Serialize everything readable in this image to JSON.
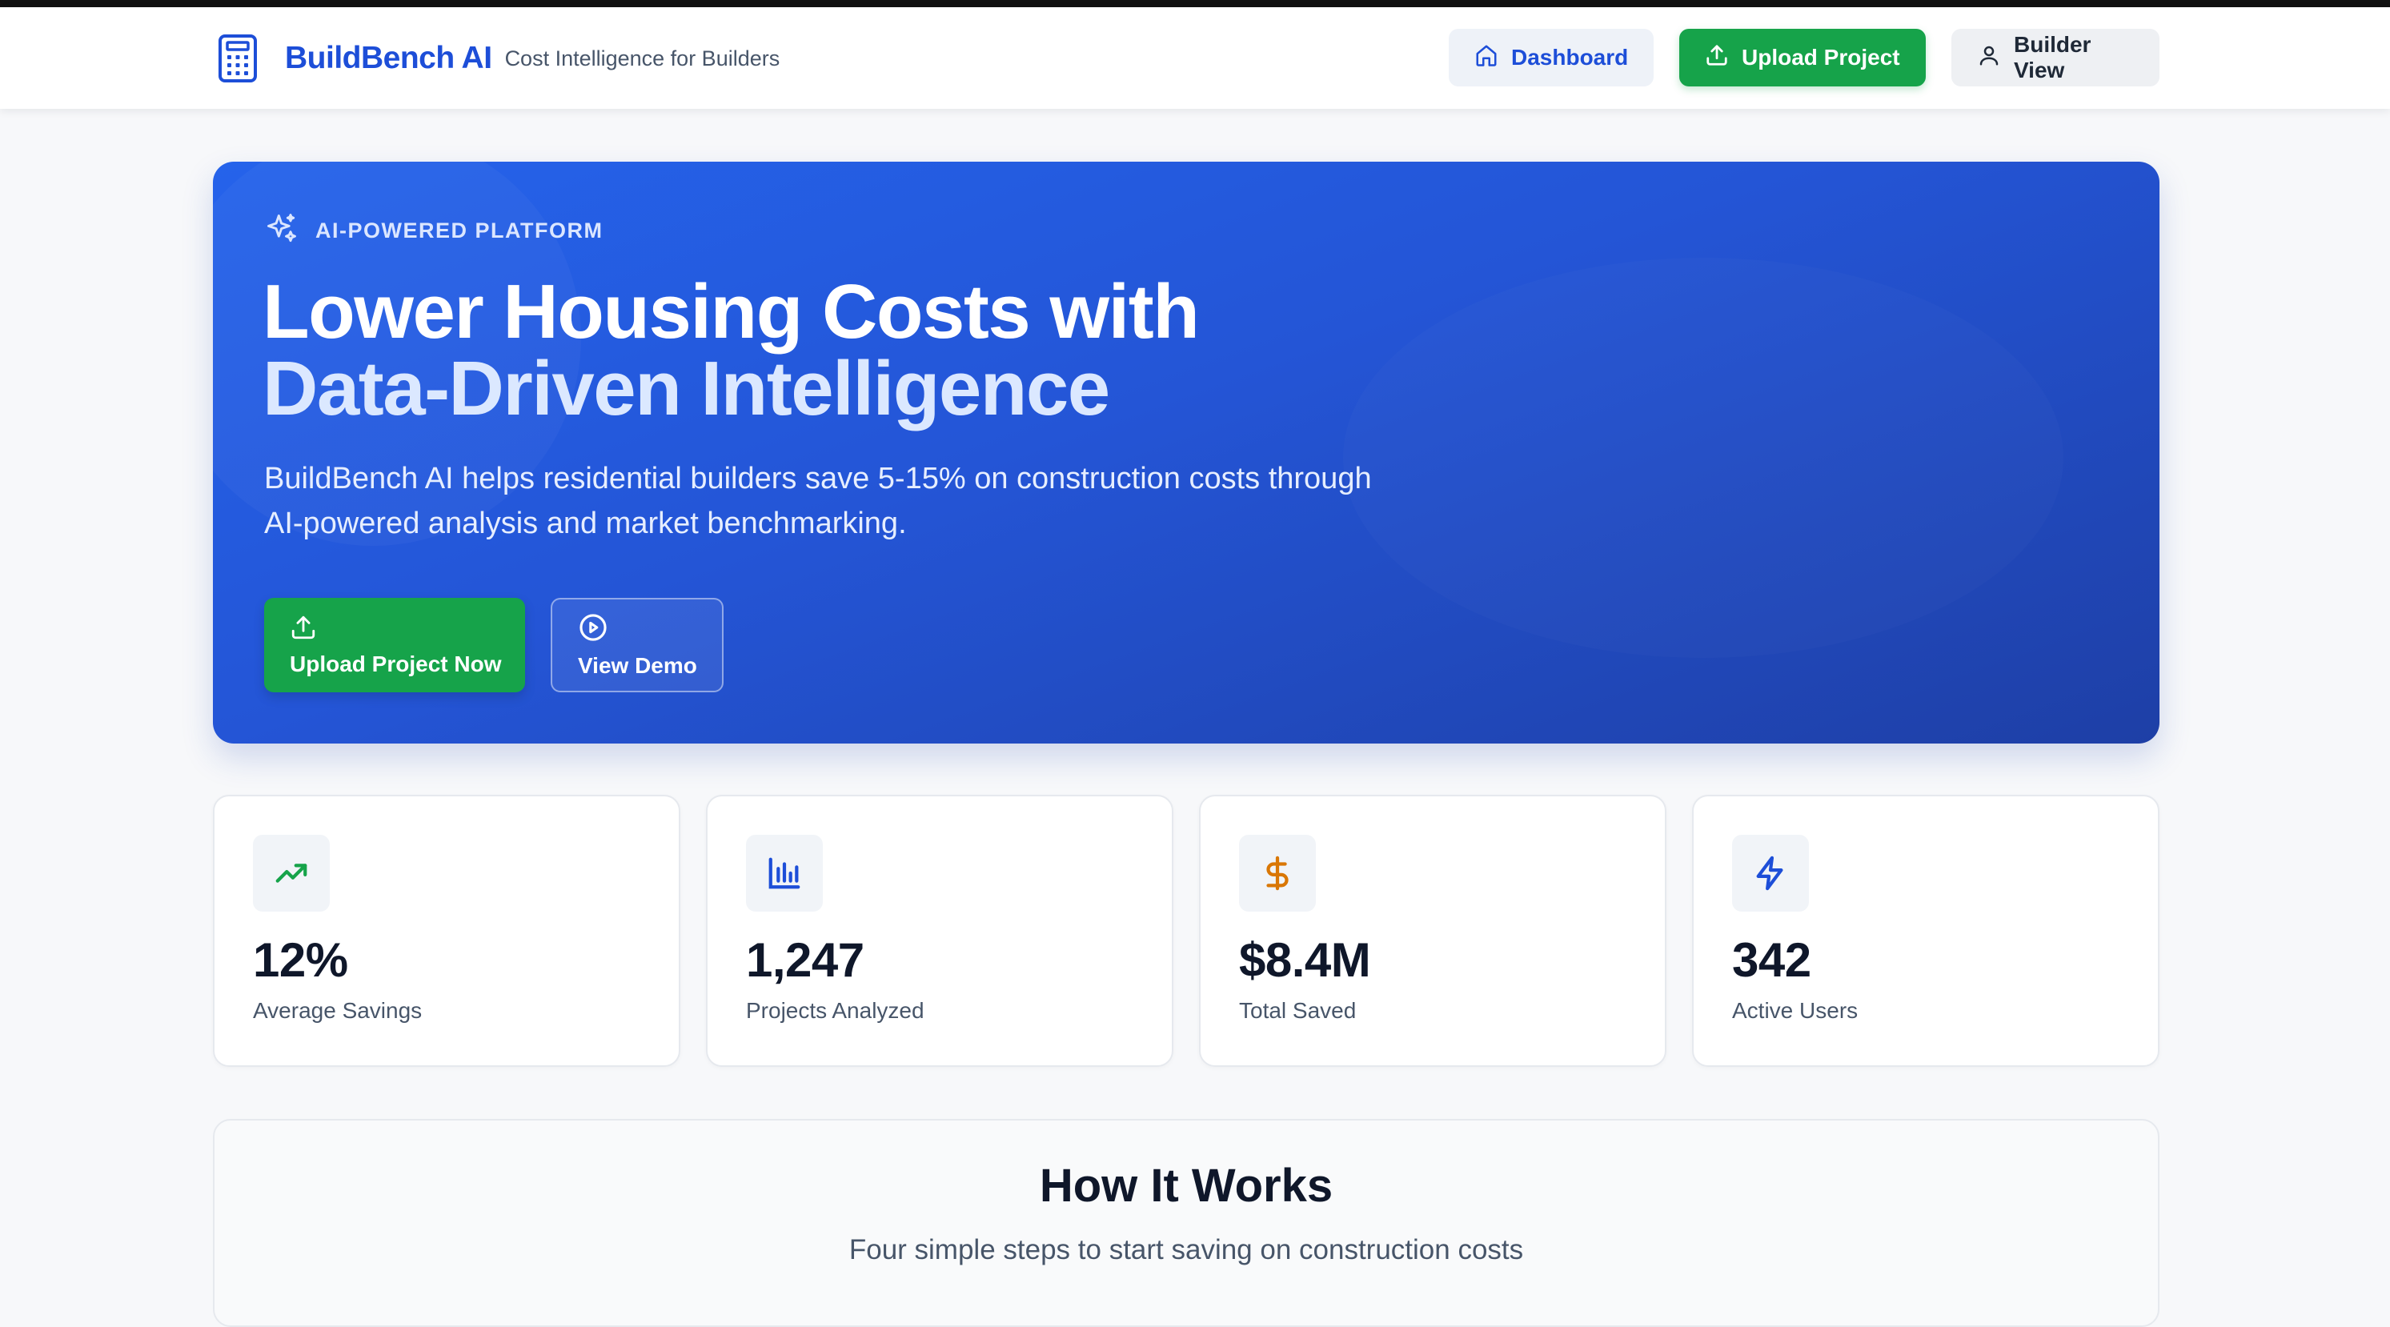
{
  "header": {
    "brand_name": "BuildBench AI",
    "brand_tagline": "Cost Intelligence for Builders",
    "brand_icon": "calculator-icon",
    "nav": [
      {
        "label": "Dashboard",
        "icon": "home-icon"
      },
      {
        "label": "Upload Project",
        "icon": "upload-icon"
      },
      {
        "label": "Builder View",
        "icon": "user-icon"
      }
    ]
  },
  "hero": {
    "badge": "AI-POWERED PLATFORM",
    "badge_icon": "sparkles-icon",
    "title_line1": "Lower Housing Costs with",
    "title_line2": "Data-Driven Intelligence",
    "subtitle": "BuildBench AI helps residential builders save 5-15% on construction costs through AI-powered analysis and market benchmarking.",
    "cta_primary": "Upload Project Now",
    "cta_secondary": "View Demo"
  },
  "stats": [
    {
      "value": "12%",
      "label": "Average Savings",
      "icon": "trending-up-icon",
      "color": "#16a34a"
    },
    {
      "value": "1,247",
      "label": "Projects Analyzed",
      "icon": "bar-chart-icon",
      "color": "#1d4ed8"
    },
    {
      "value": "$8.4M",
      "label": "Total Saved",
      "icon": "dollar-icon",
      "color": "#d97706"
    },
    {
      "value": "342",
      "label": "Active Users",
      "icon": "lightning-icon",
      "color": "#1d4ed8"
    }
  ],
  "how_it_works": {
    "title": "How It Works",
    "subtitle": "Four simple steps to start saving on construction costs"
  },
  "colors": {
    "brand": "#1d4ed8",
    "hero_start": "#2563eb",
    "hero_end": "#1e3fa6",
    "success": "#16a34a"
  }
}
